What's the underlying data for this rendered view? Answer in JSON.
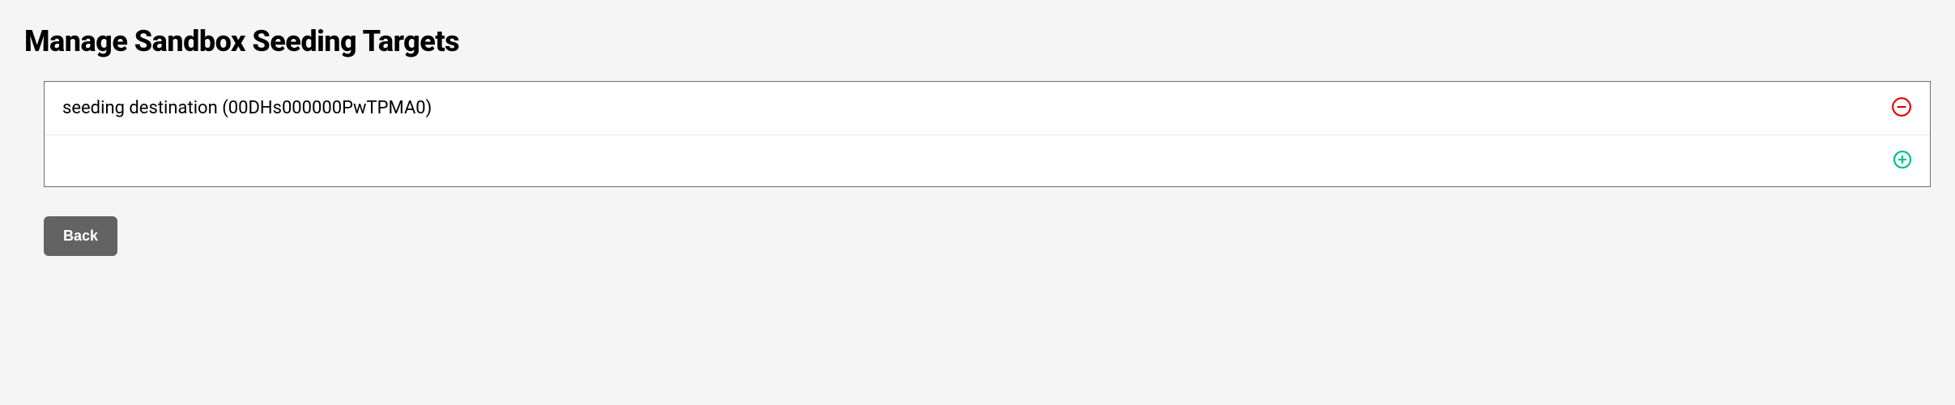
{
  "page": {
    "title": "Manage Sandbox Seeding Targets"
  },
  "targets": {
    "items": [
      {
        "label": "seeding destination (00DHs000000PwTPMA0)"
      }
    ]
  },
  "actions": {
    "back_label": "Back"
  },
  "colors": {
    "remove_icon": "#e60000",
    "add_icon": "#00c28c",
    "back_bg": "#636363"
  }
}
